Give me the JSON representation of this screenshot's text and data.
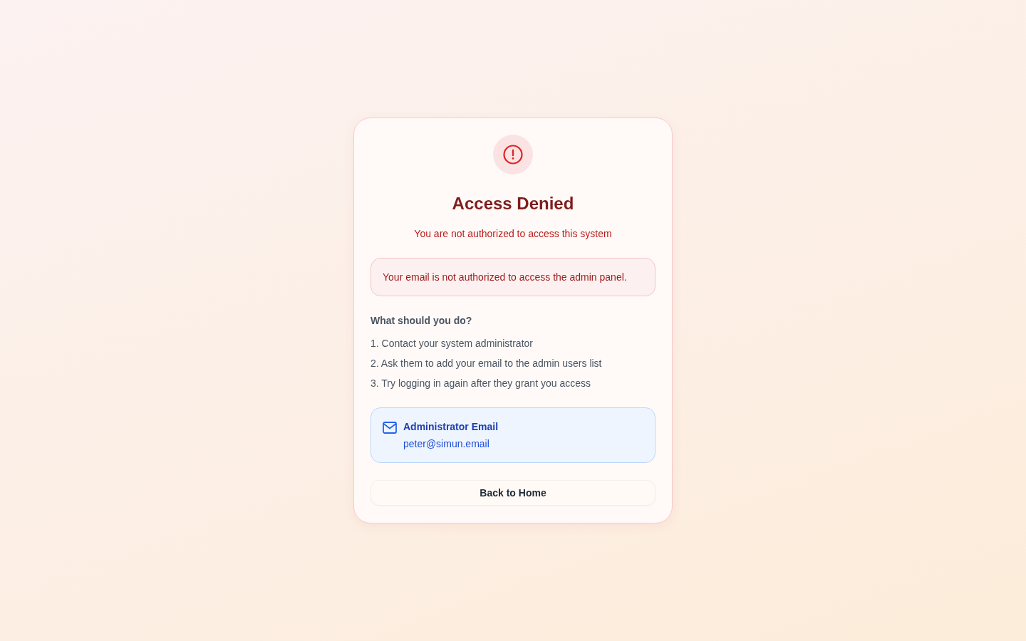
{
  "card": {
    "title": "Access Denied",
    "subtitle": "You are not authorized to access this system"
  },
  "alert": {
    "message": "Your email is not authorized to access the admin panel."
  },
  "instructions": {
    "heading": "What should you do?",
    "steps": [
      "1. Contact your system administrator",
      "2. Ask them to add your email to the admin users list",
      "3. Try logging in again after they grant you access"
    ]
  },
  "contact": {
    "label": "Administrator Email",
    "email": "peter@simun.email"
  },
  "buttons": [
    {
      "label": "Back to Home"
    }
  ]
}
